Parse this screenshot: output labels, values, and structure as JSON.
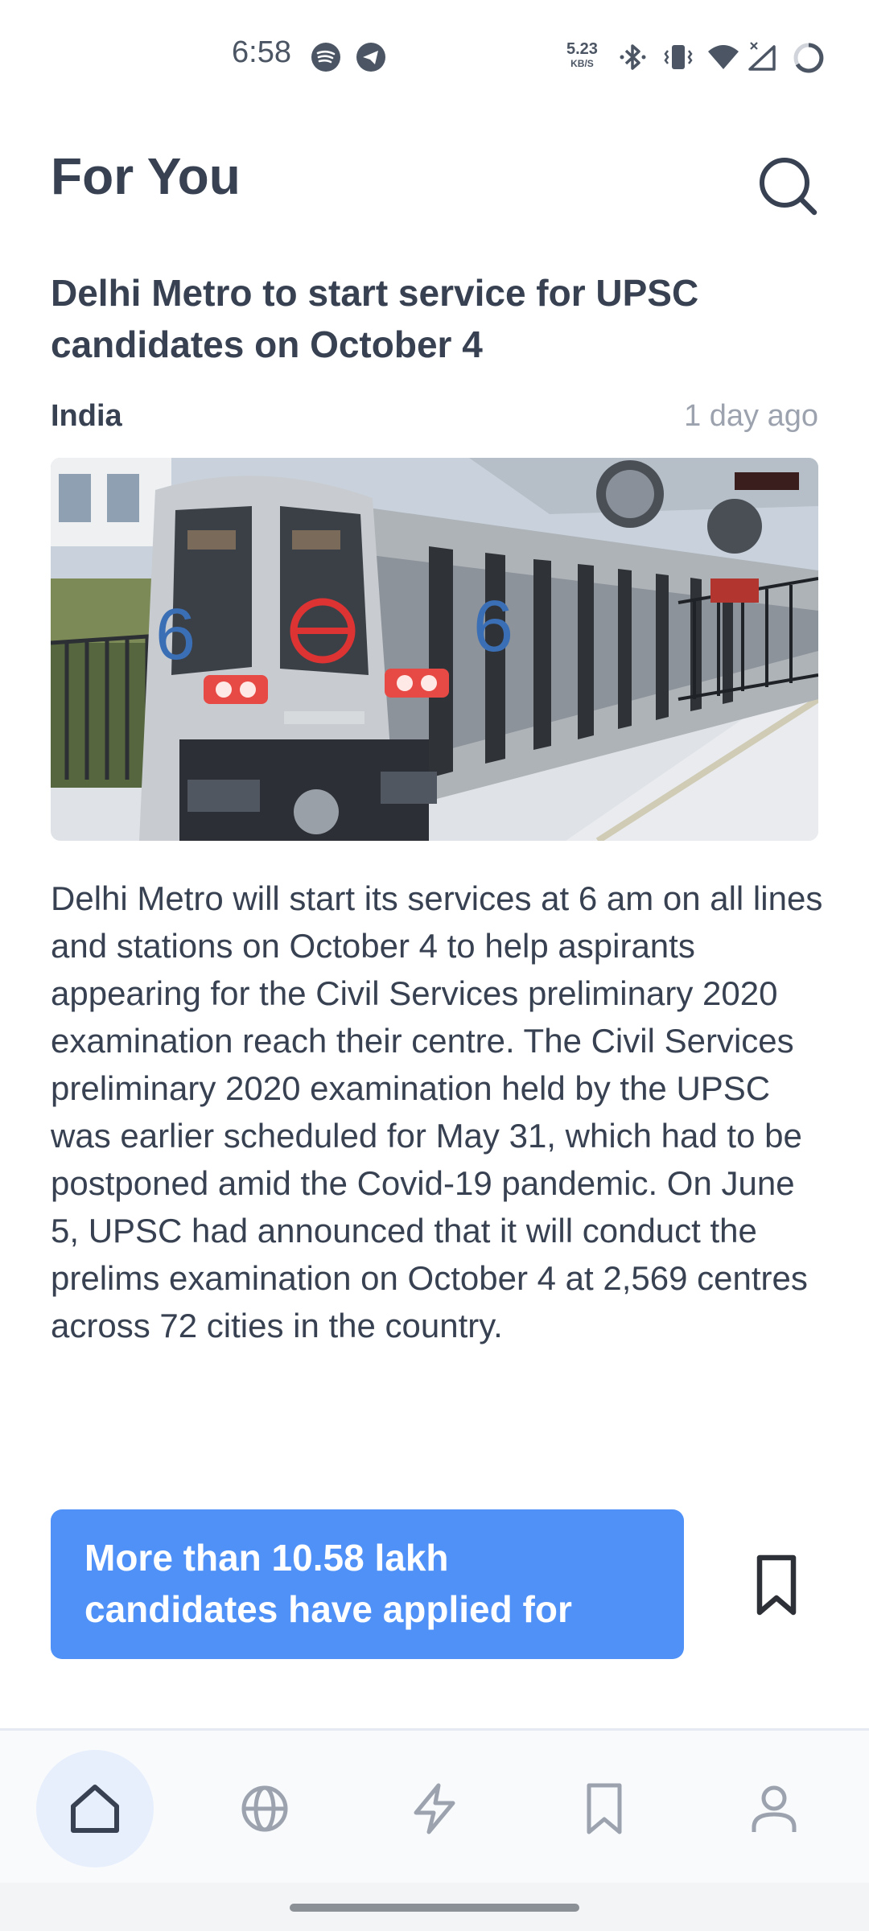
{
  "status_bar": {
    "time": "6:58",
    "net_speed_value": "5.23",
    "net_speed_unit": "KB/S",
    "icons": [
      "spotify-icon",
      "telegram-icon",
      "bluetooth-icon",
      "vibrate-icon",
      "wifi-icon",
      "no-signal-icon",
      "battery-icon"
    ]
  },
  "header": {
    "title": "For You",
    "search_icon": "search-icon"
  },
  "article": {
    "headline": "Delhi Metro to start service for UPSC candidates on October 4",
    "category": "India",
    "age": "1 day ago",
    "image_alt": "Delhi Metro train at platform",
    "body": "Delhi Metro will start its services at 6 am on all lines and stations on October 4 to help aspirants appearing for the Civil Services preliminary 2020 examination reach their centre. The Civil Services preliminary 2020 examination held by the UPSC was earlier scheduled for May 31, which had to be postponed amid the Covid-19 pandemic. On June 5, UPSC had announced that it will conduct the prelims examination on October 4 at 2,569 centres across 72 cities in the country.",
    "more_button": "More than 10.58 lakh candidates have applied for",
    "bookmark_icon": "bookmark-icon"
  },
  "bottom_nav": {
    "items": [
      {
        "icon": "home-icon",
        "active": true
      },
      {
        "icon": "globe-icon",
        "active": false
      },
      {
        "icon": "lightning-icon",
        "active": false
      },
      {
        "icon": "bookmark-icon",
        "active": false
      },
      {
        "icon": "user-icon",
        "active": false
      }
    ]
  },
  "colors": {
    "accent": "#4f91f7",
    "active_nav_bg": "#e7effd",
    "text": "#374151",
    "muted": "#9ca3af"
  }
}
